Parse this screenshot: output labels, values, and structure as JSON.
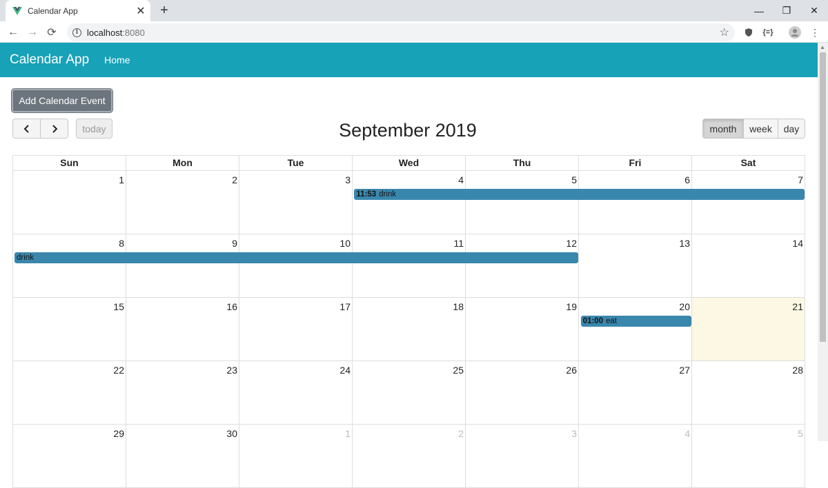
{
  "browser": {
    "tab_title": "Calendar App",
    "tab_close": "✕",
    "new_tab": "+",
    "url_host": "localhost",
    "url_port": ":8080",
    "ext_json": "{=}"
  },
  "navbar": {
    "brand": "Calendar App",
    "home": "Home"
  },
  "add_button": "Add Calendar Event",
  "calendar": {
    "title": "September 2019",
    "prev_label": "<",
    "next_label": ">",
    "today_label": "today",
    "views": [
      "month",
      "week",
      "day"
    ],
    "active_view": "month",
    "day_headers": [
      "Sun",
      "Mon",
      "Tue",
      "Wed",
      "Thu",
      "Fri",
      "Sat"
    ],
    "weeks": [
      [
        "1",
        "2",
        "3",
        "4",
        "5",
        "6",
        "7"
      ],
      [
        "8",
        "9",
        "10",
        "11",
        "12",
        "13",
        "14"
      ],
      [
        "15",
        "16",
        "17",
        "18",
        "19",
        "20",
        "21"
      ],
      [
        "22",
        "23",
        "24",
        "25",
        "26",
        "27",
        "28"
      ],
      [
        "29",
        "30",
        "1",
        "2",
        "3",
        "4",
        "5"
      ]
    ],
    "today_date": "21",
    "events": [
      {
        "time": "11:53",
        "title": "drink",
        "start_day": "4",
        "end_day": "7"
      },
      {
        "time": "",
        "title": "drink",
        "start_day": "8",
        "end_day": "12"
      },
      {
        "time": "01:00",
        "title": "eat",
        "start_day": "20",
        "end_day": "20"
      }
    ],
    "colors": {
      "event": "#3a87ad",
      "today_bg": "#fcf8e3",
      "navbar": "#17a2b8"
    }
  }
}
